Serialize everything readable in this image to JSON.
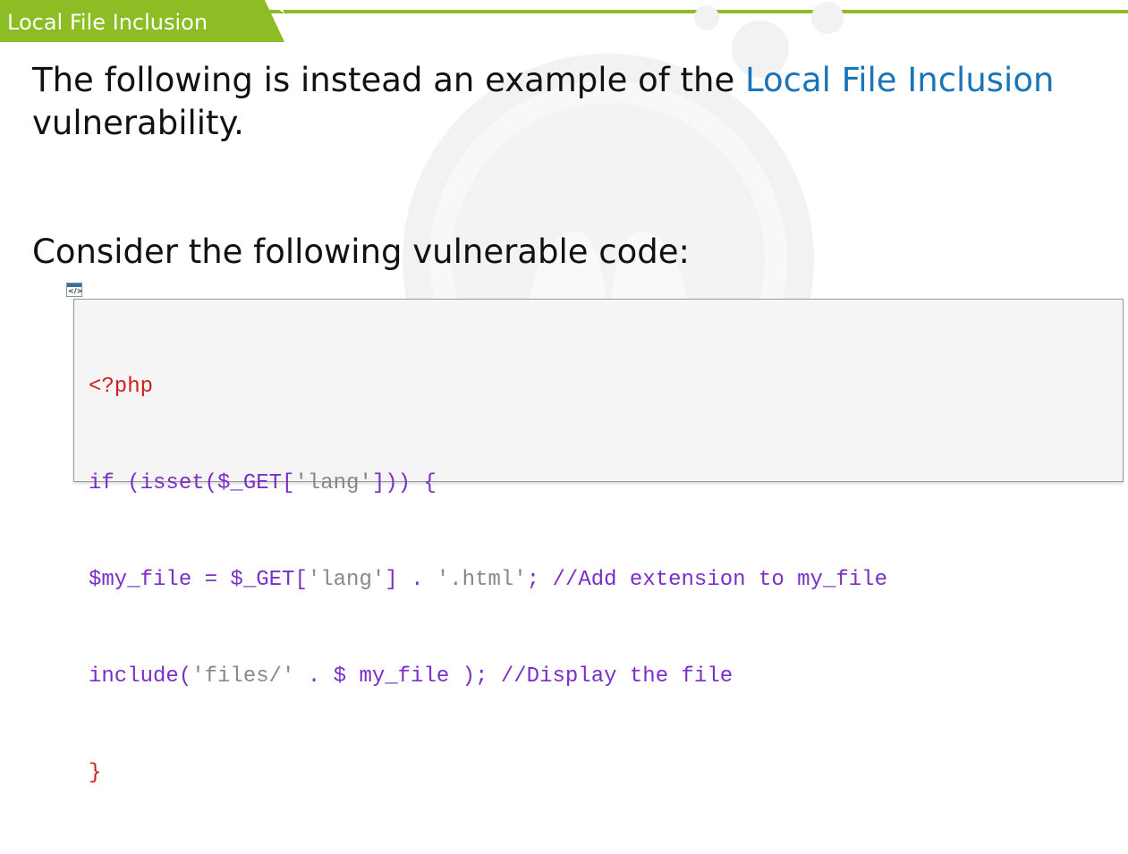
{
  "header": {
    "tab_label": "Local File Inclusion",
    "accent_color": "#8cbd25"
  },
  "content": {
    "para1_before": "The following is instead an example of the ",
    "para1_highlight": "Local File Inclusion",
    "para1_after": "vulnerability.",
    "para2": "Consider the following vulnerable code:"
  },
  "code": {
    "icon_label": "</>",
    "line1": "<?php",
    "line2_a": "if (isset($_GET[",
    "line2_b": "'lang'",
    "line2_c": "])) {",
    "line3_a": "$my_file = $_GET[",
    "line3_b": "'lang'",
    "line3_c": "] . ",
    "line3_d": "'.html'",
    "line3_e": "; //Add extension to my_file",
    "line4_a": "include(",
    "line4_b": "'files/'",
    "line4_c": " . $ my_file ); //Display the file",
    "line5": "}"
  },
  "colors": {
    "highlight": "#1a74b8",
    "code_tag": "#d01e1e",
    "code_keyword": "#7a2fc9",
    "code_string": "#888888"
  }
}
